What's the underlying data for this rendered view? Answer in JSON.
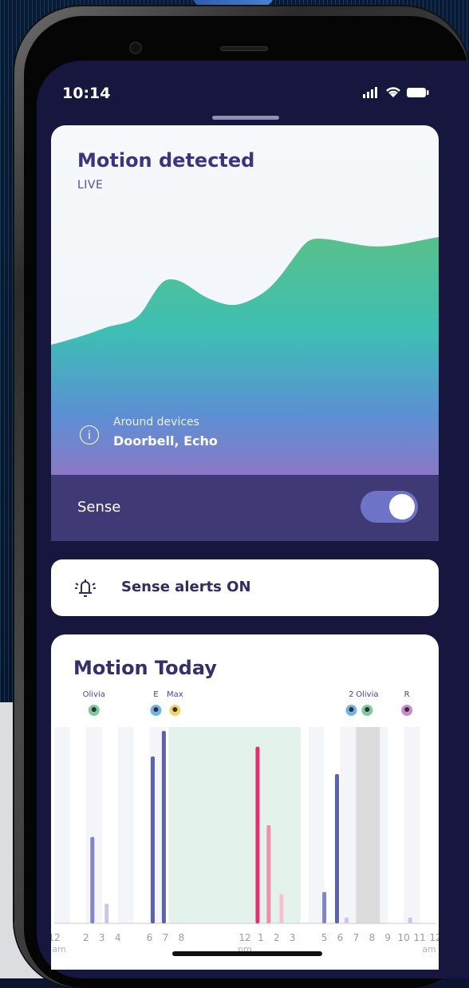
{
  "status": {
    "time": "10:14",
    "icons": [
      "signal-icon",
      "wifi-icon",
      "battery-icon"
    ]
  },
  "motion_card": {
    "title": "Motion detected",
    "subtitle": "LIVE",
    "around_label": "Around devices",
    "around_value": "Doorbell, Echo",
    "sense_label": "Sense",
    "sense_toggle_on": true
  },
  "alerts": {
    "label": "Sense alerts ON"
  },
  "today": {
    "title": "Motion Today",
    "people": [
      {
        "label": "Olivia",
        "slot": 2.5,
        "avatar": "olivia-avatar"
      },
      {
        "label": "E",
        "slot": 6.4,
        "avatar": "e-avatar"
      },
      {
        "label": "Max",
        "slot": 7.6,
        "avatar": "max-avatar"
      },
      {
        "label": "2",
        "slot": 18.7,
        "avatar": "2-avatar"
      },
      {
        "label": "Olivia",
        "slot": 19.7,
        "avatar": "olivia-avatar"
      },
      {
        "label": "R",
        "slot": 22.2,
        "avatar": "r-avatar"
      }
    ],
    "x_ticks": [
      "12",
      "2",
      "3",
      "4",
      "6",
      "7",
      "8",
      "12",
      "1",
      "2",
      "3",
      "5",
      "6",
      "7",
      "8",
      "9",
      "10",
      "11",
      "12"
    ],
    "x_tick_slots": [
      0,
      2,
      3,
      4,
      6,
      7,
      8,
      12,
      13,
      14,
      15,
      17,
      18,
      19,
      20,
      21,
      22,
      23,
      24
    ],
    "period_labels": [
      "am",
      "pm",
      "am"
    ],
    "bars": [
      {
        "slot": 2.4,
        "height": 0.44,
        "color": "#7f84cd"
      },
      {
        "slot": 3.3,
        "height": 0.1,
        "color": "#c6c8eb"
      },
      {
        "slot": 6.2,
        "height": 0.85,
        "color": "#5b61b3"
      },
      {
        "slot": 6.9,
        "height": 0.98,
        "color": "#5b61b3"
      },
      {
        "slot": 12.8,
        "height": 0.9,
        "color": "#e82e72"
      },
      {
        "slot": 13.5,
        "height": 0.5,
        "color": "#ee8ea8"
      },
      {
        "slot": 14.3,
        "height": 0.15,
        "color": "#f6c2cf"
      },
      {
        "slot": 17.0,
        "height": 0.16,
        "color": "#7f84cd"
      },
      {
        "slot": 17.8,
        "height": 0.76,
        "color": "#5b61b3"
      },
      {
        "slot": 18.4,
        "height": 0.03,
        "color": "#c6c8eb"
      },
      {
        "slot": 22.4,
        "height": 0.03,
        "color": "#c6c8eb"
      }
    ],
    "highlight_span": [
      7.2,
      15.5
    ],
    "gray_span": [
      19.0,
      20.5
    ]
  }
}
